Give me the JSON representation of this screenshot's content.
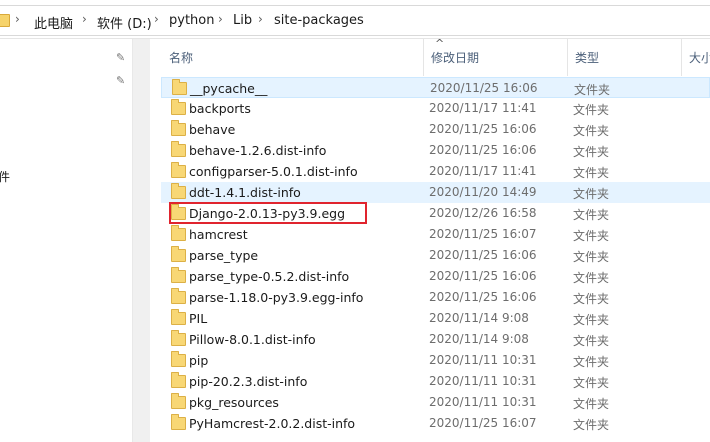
{
  "breadcrumbs": [
    "此电脑",
    "软件 (D:)",
    "python",
    "Lib",
    "site-packages"
  ],
  "nav": {
    "partial_label": "件"
  },
  "columns": {
    "name": "名称",
    "modified": "修改日期",
    "type": "类型",
    "size": "大小"
  },
  "files": [
    {
      "name": "__pycache__",
      "date": "2020/11/25 16:06",
      "type": "文件夹"
    },
    {
      "name": "backports",
      "date": "2020/11/17 11:41",
      "type": "文件夹"
    },
    {
      "name": "behave",
      "date": "2020/11/25 16:06",
      "type": "文件夹"
    },
    {
      "name": "behave-1.2.6.dist-info",
      "date": "2020/11/25 16:06",
      "type": "文件夹"
    },
    {
      "name": "configparser-5.0.1.dist-info",
      "date": "2020/11/17 11:41",
      "type": "文件夹"
    },
    {
      "name": "ddt-1.4.1.dist-info",
      "date": "2020/11/20 14:49",
      "type": "文件夹"
    },
    {
      "name": "Django-2.0.13-py3.9.egg",
      "date": "2020/12/26 16:58",
      "type": "文件夹"
    },
    {
      "name": "hamcrest",
      "date": "2020/11/25 16:07",
      "type": "文件夹"
    },
    {
      "name": "parse_type",
      "date": "2020/11/25 16:06",
      "type": "文件夹"
    },
    {
      "name": "parse_type-0.5.2.dist-info",
      "date": "2020/11/25 16:06",
      "type": "文件夹"
    },
    {
      "name": "parse-1.18.0-py3.9.egg-info",
      "date": "2020/11/25 16:06",
      "type": "文件夹"
    },
    {
      "name": "PIL",
      "date": "2020/11/14 9:08",
      "type": "文件夹"
    },
    {
      "name": "Pillow-8.0.1.dist-info",
      "date": "2020/11/14 9:08",
      "type": "文件夹"
    },
    {
      "name": "pip",
      "date": "2020/11/11 10:31",
      "type": "文件夹"
    },
    {
      "name": "pip-20.2.3.dist-info",
      "date": "2020/11/11 10:31",
      "type": "文件夹"
    },
    {
      "name": "pkg_resources",
      "date": "2020/11/11 10:31",
      "type": "文件夹"
    },
    {
      "name": "PyHamcrest-2.0.2.dist-info",
      "date": "2020/11/25 16:07",
      "type": "文件夹"
    }
  ],
  "colors": {
    "selection_bg": "#e5f3ff",
    "highlight_border": "#e0242e",
    "folder": "#f8d775"
  }
}
